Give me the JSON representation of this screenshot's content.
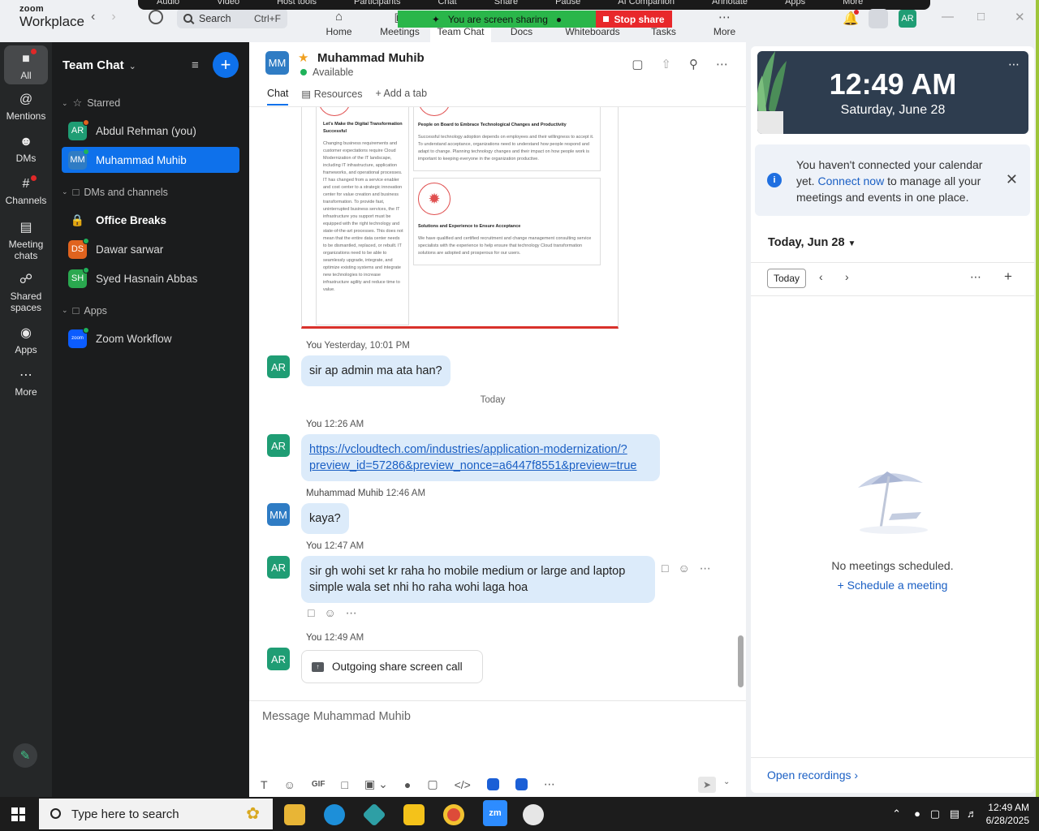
{
  "titlebar": {
    "logo_small": "zoom",
    "logo_big": "Workplace",
    "search_label": "Search",
    "search_shortcut": "Ctrl+F",
    "nav": [
      {
        "label": "Home",
        "icon": "home-icon"
      },
      {
        "label": "Meetings",
        "icon": "video-icon"
      },
      {
        "label": "Team Chat",
        "icon": "chat-icon"
      },
      {
        "label": "Docs",
        "icon": "doc-icon"
      },
      {
        "label": "Whiteboards",
        "icon": "whiteboard-icon"
      },
      {
        "label": "Tasks",
        "icon": "tasks-icon"
      },
      {
        "label": "More",
        "icon": "more-icon"
      }
    ],
    "share_toolbar": [
      "Audio",
      "Video",
      "Host tools",
      "Participants",
      "Chat",
      "Share",
      "Pause",
      "AI Companion",
      "Annotate",
      "Apps",
      "More"
    ],
    "sharing_banner": "You are screen sharing",
    "stop_share": "Stop share",
    "user_initials": "AR"
  },
  "rail": {
    "items": [
      {
        "label": "All",
        "icon": "chat-bubble-icon"
      },
      {
        "label": "Mentions",
        "icon": "at-icon"
      },
      {
        "label": "DMs",
        "icon": "people-icon"
      },
      {
        "label": "Channels",
        "icon": "hash-icon"
      },
      {
        "label": "Meeting chats",
        "icon": "calendar-icon"
      },
      {
        "label": "Shared spaces",
        "icon": "shared-spaces-icon"
      },
      {
        "label": "Apps",
        "icon": "apps-icon"
      },
      {
        "label": "More",
        "icon": "more-icon"
      }
    ]
  },
  "sidebar": {
    "title": "Team Chat",
    "sections": {
      "starred": "Starred",
      "dms": "DMs and channels",
      "apps": "Apps"
    },
    "starred_items": [
      {
        "name": "Abdul Rehman (you)",
        "initials": "AR",
        "color": "#1f9d74"
      },
      {
        "name": "Muhammad Muhib",
        "initials": "MM",
        "color": "#2f7cc4"
      }
    ],
    "dm_items": [
      {
        "name": "Office Breaks"
      },
      {
        "name": "Dawar sarwar",
        "initials": "DS",
        "color": "#e0631e"
      },
      {
        "name": "Syed Hasnain Abbas",
        "initials": "SH",
        "color": "#2aa84f"
      }
    ],
    "app_items": [
      {
        "name": "Zoom Workflow",
        "initials": "zoom",
        "color": "#0b5cff"
      }
    ]
  },
  "chat": {
    "contact_name": "Muhammad Muhib",
    "contact_initials": "MM",
    "contact_status": "Available",
    "tabs": [
      "Chat",
      "Resources",
      "Add a tab"
    ],
    "preview": {
      "left_title": "Let's Make the Digital Transformation Successful",
      "left_body": "Changing business requirements and customer expectations require Cloud Modernization of the IT landscape, including IT infrastructure, application frameworks, and operational processes. IT has changed from a service enabler and cost center to a strategic innovation center for value creation and business transformation. To provide fast, uninterrupted business services, the IT infrastructure you support must be equipped with the right technology and state-of-the-art processes. This does not mean that the entire data center needs to be dismantled, replaced, or rebuilt. IT organizations need to be able to seamlessly upgrade, integrate, and optimize existing systems and integrate new technologies to increase infrastructure agility and reduce time to value.",
      "right1_title": "People on Board to Embrace Technological Changes and Productivity",
      "right1_body": "Successful technology adoption depends on employees and their willingness to accept it. To understand acceptance, organizations need to understand how people respond and adapt to change. Planning technology changes and their impact on how people work is important to keeping everyone in the organization productive.",
      "right2_title": "Solutions and Experience to Ensure Acceptance",
      "right2_body": "We have qualified and certified recruitment and change management consulting service specialists with the experience to help ensure that technology Cloud transformation solutions are adopted and prosperous for our users."
    },
    "messages": [
      {
        "sender": "You",
        "time": "Yesterday, 10:01 PM",
        "initials": "AR",
        "text": "sir ap admin ma ata han?"
      },
      {
        "separator": "Today"
      },
      {
        "sender": "You",
        "time": "12:26 AM",
        "initials": "AR",
        "link": "https://vcloudtech.com/industries/application-modernization/?preview_id=57286&preview_nonce=a6447f8551&preview=true",
        "link_line1": "https://vcloudtech.com/industries/application-modernization/?",
        "link_line2": "preview_id=57286&preview_nonce=a6447f8551&preview=true"
      },
      {
        "sender": "Muhammad Muhib",
        "time": "12:46 AM",
        "initials": "MM",
        "text": "kaya?"
      },
      {
        "sender": "You",
        "time": "12:47 AM",
        "initials": "AR",
        "line1": "sir gh wohi set kr raha ho mobile medium or  large and laptop",
        "line2": "simple wala set nhi ho raha wohi laga hoa"
      },
      {
        "sender": "You",
        "time": "12:49 AM",
        "initials": "AR",
        "call": "Outgoing share screen call"
      }
    ],
    "composer_placeholder": "Message Muhammad Muhib",
    "composer_gif": "GIF"
  },
  "right_panel": {
    "clock_time": "12:49 AM",
    "clock_date": "Saturday, June 28",
    "cal_note_pre": "You haven't connected your calendar yet.",
    "cal_note_link": "Connect now",
    "cal_note_post": "to manage all your meetings and events in one place.",
    "today_heading": "Today, Jun 28",
    "today_button": "Today",
    "empty_text": "No meetings scheduled.",
    "schedule_link": "Schedule a meeting",
    "open_recordings": "Open recordings"
  },
  "taskbar": {
    "search_placeholder": "Type here to search",
    "time": "12:49 AM",
    "date": "6/28/2025"
  }
}
